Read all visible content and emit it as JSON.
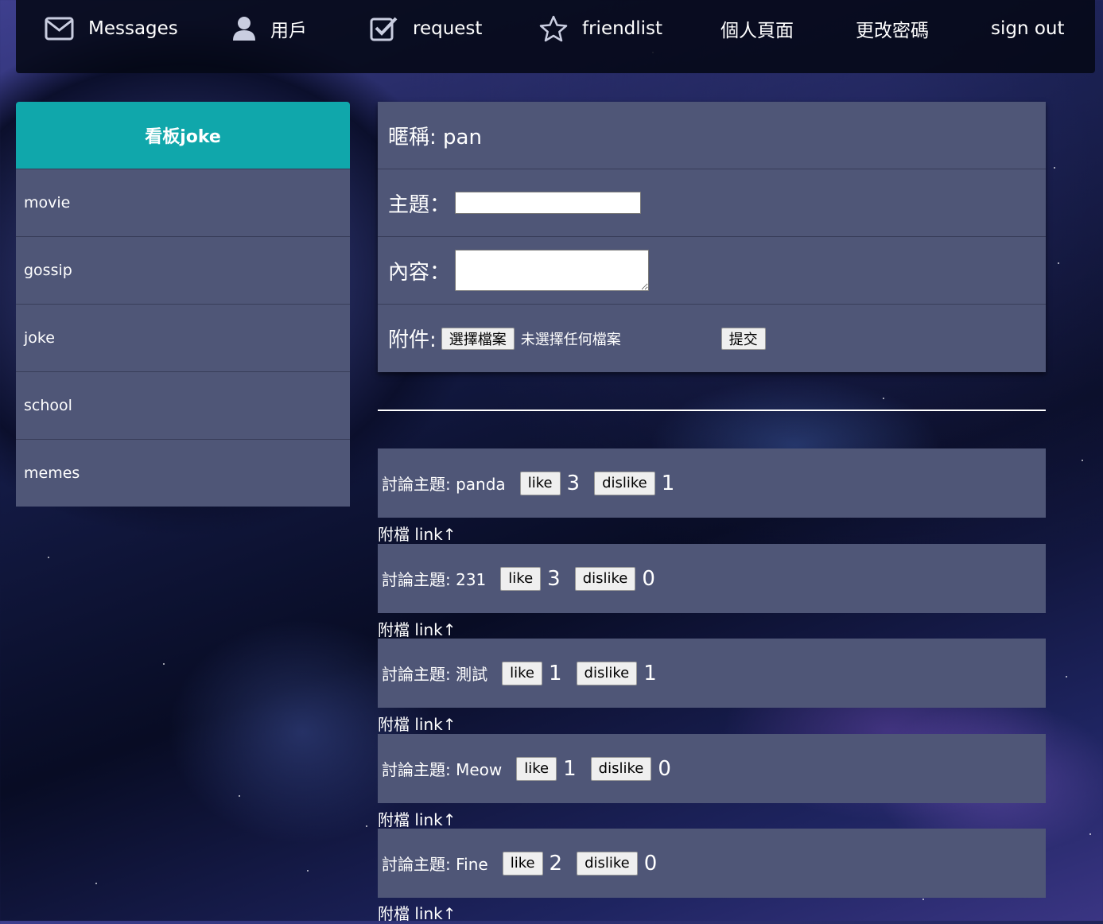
{
  "nav": {
    "items": [
      {
        "label": "Messages",
        "icon": "envelope-icon"
      },
      {
        "label": "用戶",
        "icon": "user-icon"
      },
      {
        "label": "request",
        "icon": "check-square-icon"
      },
      {
        "label": "friendlist",
        "icon": "star-icon"
      },
      {
        "label": "個人頁面"
      },
      {
        "label": "更改密碼"
      },
      {
        "label": "sign out"
      }
    ]
  },
  "sidebar": {
    "title": "看板joke",
    "items": [
      {
        "label": "movie"
      },
      {
        "label": "gossip"
      },
      {
        "label": "joke"
      },
      {
        "label": "school"
      },
      {
        "label": "memes"
      }
    ]
  },
  "form": {
    "nickname_label": "暱稱: pan",
    "topic_label": "主題：",
    "topic_value": "",
    "content_label": "內容：",
    "content_value": "",
    "attach_label": "附件:",
    "choose_file_label": "選擇檔案",
    "file_status": "未選擇任何檔案",
    "submit_label": "提交"
  },
  "posts": [
    {
      "topic": "討論主題: panda",
      "like_label": "like",
      "likes": "3",
      "dislike_label": "dislike",
      "dislikes": "1",
      "attach": "附檔 link↑"
    },
    {
      "topic": "討論主題: 231",
      "like_label": "like",
      "likes": "3",
      "dislike_label": "dislike",
      "dislikes": "0",
      "attach": "附檔 link↑"
    },
    {
      "topic": "討論主題: 測試",
      "like_label": "like",
      "likes": "1",
      "dislike_label": "dislike",
      "dislikes": "1",
      "attach": "附檔 link↑"
    },
    {
      "topic": "討論主題: Meow",
      "like_label": "like",
      "likes": "1",
      "dislike_label": "dislike",
      "dislikes": "0",
      "attach": "附檔 link↑"
    },
    {
      "topic": "討論主題: Fine",
      "like_label": "like",
      "likes": "2",
      "dislike_label": "dislike",
      "dislikes": "0",
      "attach": "附檔 link↑"
    }
  ]
}
